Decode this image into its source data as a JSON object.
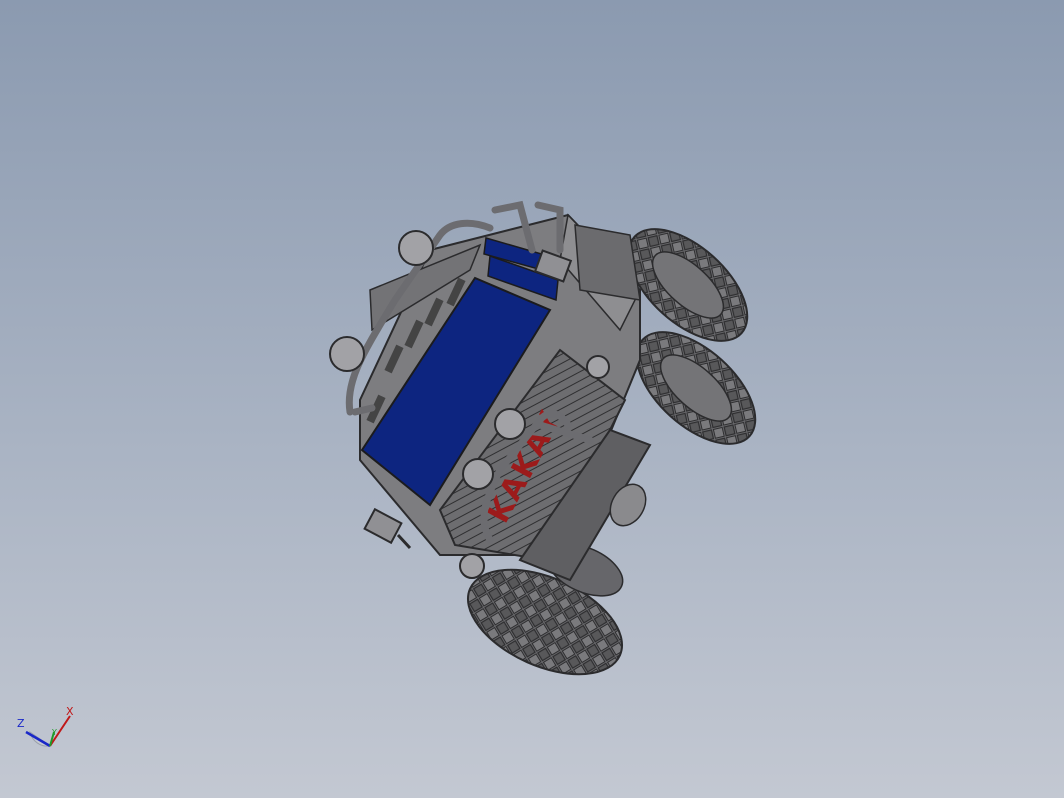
{
  "viewport": {
    "background_top": "#8b9ab0",
    "background_bottom": "#c3c8d2"
  },
  "model": {
    "body_color": "#7d7d80",
    "panel_color": "#0d2580",
    "tire_color": "#5a5a5c",
    "brand_text": "KAKAY",
    "brand_color": "#9c1b1b"
  },
  "triad": {
    "axis_x": "X",
    "axis_y": "Y",
    "axis_z": "Z",
    "color_x": "#c01818",
    "color_y": "#1f9a2a",
    "color_z": "#1a28c8"
  }
}
